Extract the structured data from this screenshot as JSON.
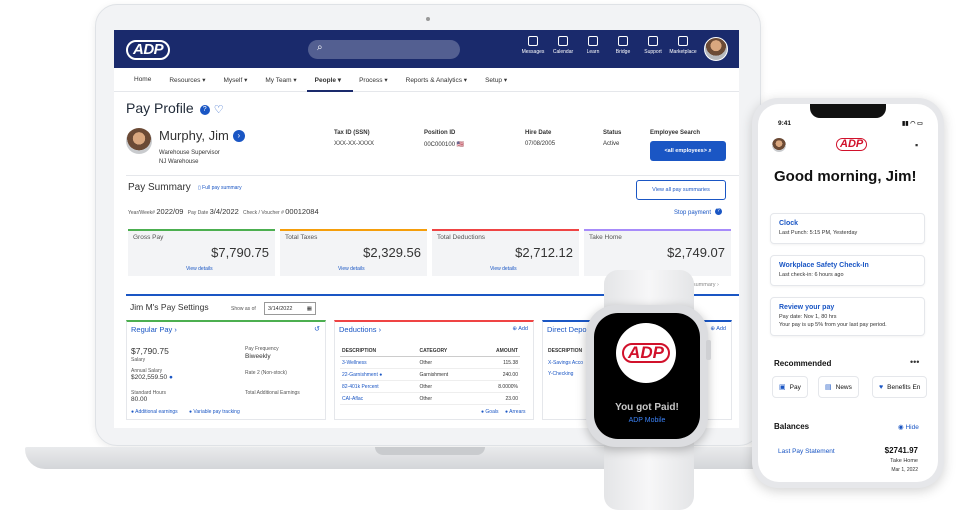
{
  "app": {
    "logo": "ADP"
  },
  "topbar": {
    "icons": [
      {
        "label": "Messages",
        "icon": "messages-icon"
      },
      {
        "label": "Calendar",
        "icon": "calendar-icon"
      },
      {
        "label": "Learn",
        "icon": "learn-icon"
      },
      {
        "label": "Bridge",
        "icon": "bridge-icon"
      },
      {
        "label": "Support",
        "icon": "support-icon"
      },
      {
        "label": "Marketplace",
        "icon": "marketplace-icon"
      }
    ]
  },
  "nav": [
    "Home",
    "Resources ▾",
    "Myself ▾",
    "My Team ▾",
    "People ▾",
    "Process ▾",
    "Reports & Analytics ▾",
    "Setup ▾"
  ],
  "page": {
    "title": "Pay Profile",
    "employee": {
      "name": "Murphy, Jim",
      "role": "Warehouse Supervisor",
      "location": "NJ Warehouse"
    },
    "fields": [
      {
        "label": "Tax ID (SSN)",
        "value": "XXX-XX-XXXX"
      },
      {
        "label": "Position ID",
        "value": "00C000100 🇺🇸"
      },
      {
        "label": "Hire Date",
        "value": "07/08/2005"
      },
      {
        "label": "Status",
        "value": "Active"
      }
    ],
    "employee_search": {
      "label": "Employee Search",
      "button": "<all employees>"
    }
  },
  "pay_summary": {
    "title": "Pay Summary",
    "full_link": "Full pay summary",
    "all_button": "View all pay summaries",
    "year_label": "Year/Week#",
    "year_value": "2022/09",
    "pay_date_label": "Pay Date",
    "pay_date_value": "3/4/2022",
    "check_label": "Check / Voucher #",
    "check_value": "00012084",
    "stop_payment": "Stop payment",
    "cards": [
      {
        "label": "Gross Pay",
        "amount": "$7,790.75",
        "link": "View details",
        "color": "#4caf50"
      },
      {
        "label": "Total Taxes",
        "amount": "$2,329.56",
        "link": "View details",
        "color": "#f59e0b"
      },
      {
        "label": "Total Deductions",
        "amount": "$2,712.12",
        "link": "View details",
        "color": "#ef4444"
      },
      {
        "label": "Take Home",
        "amount": "$2,749.07",
        "link": "",
        "color": "#a78bfa"
      }
    ],
    "next_summary": "ext summary"
  },
  "settings": {
    "title": "Jim M's Pay Settings",
    "show_as_of": "Show as of",
    "date": "3/14/2022",
    "regular_pay": {
      "title": "Regular Pay",
      "salary_amount": "$7,790.75",
      "salary_label": "Salary",
      "pay_freq_label": "Pay Frequency",
      "pay_freq_value": "Biweekly",
      "annual_label": "Annual Salary",
      "annual_value": "$202,559.50",
      "rate2_label": "Rate 2 (Non-stock)",
      "std_hours_label": "Standard Hours",
      "std_hours_value": "80.00",
      "total_add_label": "Total Additional Earnings",
      "link1": "Additional earnings",
      "link2": "Variable pay tracking"
    },
    "deductions": {
      "title": "Deductions",
      "add": "Add",
      "headers": [
        "DESCRIPTION",
        "CATEGORY",
        "AMOUNT"
      ],
      "rows": [
        [
          "3-Wellness",
          "Other",
          "115.38"
        ],
        [
          "22-Garnishment",
          "Garnishment",
          "240.00"
        ],
        [
          "82-401k Percent",
          "Other",
          "8.0000%"
        ],
        [
          "CAI-Aflac",
          "Other",
          "23.00"
        ]
      ],
      "goals": "Goals",
      "arrears": "Arrears"
    },
    "direct_deposit": {
      "title": "Direct Depo",
      "add": "Add",
      "header": "DESCRIPTION",
      "rows": [
        "X-Savings Acco",
        "Y-Checking"
      ]
    }
  },
  "watch": {
    "message": "You got Paid!",
    "sub": "ADP Mobile"
  },
  "phone": {
    "time": "9:41",
    "greeting": "Good morning, Jim!",
    "cards": [
      {
        "title": "Clock",
        "lines": [
          "Last Punch: 5:15 PM, Yesterday"
        ]
      },
      {
        "title": "Workplace Safety Check-In",
        "lines": [
          "Last check-in: 6 hours ago"
        ]
      },
      {
        "title": "Review your pay",
        "lines": [
          "Pay date: Nov 1, 80 hrs",
          "Your pay is up 5% from your last pay period."
        ]
      }
    ],
    "recommended": "Recommended",
    "chips": [
      "Pay",
      "News",
      "Benefits En"
    ],
    "balances": "Balances",
    "hide": "Hide",
    "last_pay_label": "Last Pay Statement",
    "last_pay_amount": "$2741.97",
    "take_home": "Take Home",
    "date": "Mar 1, 2022"
  }
}
